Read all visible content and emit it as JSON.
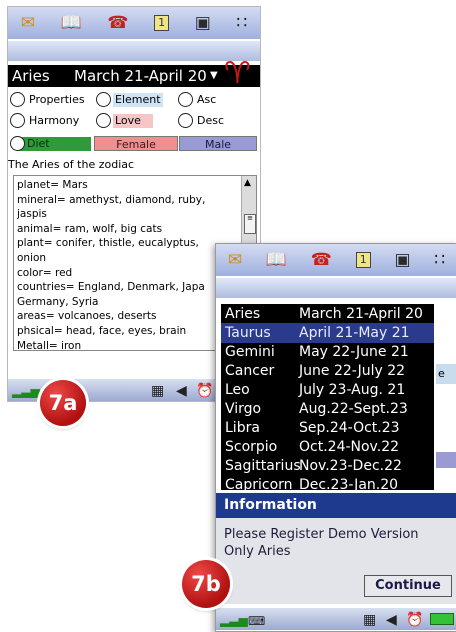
{
  "top_icons": [
    "mail-icon",
    "book-icon",
    "phone-icon",
    "calendar-icon",
    "save-icon",
    "apps-grid-icon"
  ],
  "screen_a": {
    "header": {
      "sign": "Aries",
      "dates": "March 21-April 20",
      "dropdown_glyph": "▼",
      "symbol": "♈"
    },
    "radios": {
      "properties": "Properties",
      "element": "Element",
      "asc": "Asc",
      "harmony": "Harmony",
      "love": "Love",
      "desc": "Desc",
      "diet": "Diet"
    },
    "tabs": {
      "female": "Female",
      "male": "Male"
    },
    "intro": "The Aries of the zodiac",
    "info_lines": [
      "planet= Mars",
      "mineral= amethyst, diamond, ruby,",
      "jaspis",
      "animal= ram, wolf, big cats",
      "plant= conifer, thistle, eucalyptus,",
      "onion",
      "color= red",
      "countries= England, Denmark, Japa",
      "Germany, Syria",
      "areas= volcanoes, deserts",
      "phsical= head, face, eyes, brain",
      "Metall= iron"
    ],
    "badge": "7a"
  },
  "screen_b": {
    "signs": [
      {
        "name": "Aries",
        "dates": "March 21-April 20"
      },
      {
        "name": "Taurus",
        "dates": "April 21-May 21"
      },
      {
        "name": "Gemini",
        "dates": "May 22-June 21"
      },
      {
        "name": "Cancer",
        "dates": "June 22-July 22"
      },
      {
        "name": "Leo",
        "dates": "July 23-Aug. 21"
      },
      {
        "name": "Virgo",
        "dates": "Aug.22-Sept.23"
      },
      {
        "name": "Libra",
        "dates": "Sep.24-Oct.23"
      },
      {
        "name": "Scorpio",
        "dates": "Oct.24-Nov.22"
      },
      {
        "name": "Sagittarius",
        "dates": "Nov.23-Dec.22"
      },
      {
        "name": "Capricorn",
        "dates": "Dec.23-Jan.20"
      }
    ],
    "selected": "Taurus",
    "peek_letter": "e",
    "dialog": {
      "title": "Information",
      "line1": "Please Register Demo Version",
      "line2": "Only Aries",
      "button": "Continue"
    },
    "badge": "7b"
  },
  "colors": {
    "header_bg": "#000000",
    "aries_symbol": "#c81818",
    "element_pill": "#cfe4f4",
    "love_pill": "#f6c6c6",
    "diet_pill": "#2e9a3a",
    "female_tab": "#f08f8f",
    "male_tab": "#9a9ad4",
    "selected_row": "#2a3a8c",
    "dialog_title": "#1e3a8e",
    "badge": "#c01818"
  }
}
